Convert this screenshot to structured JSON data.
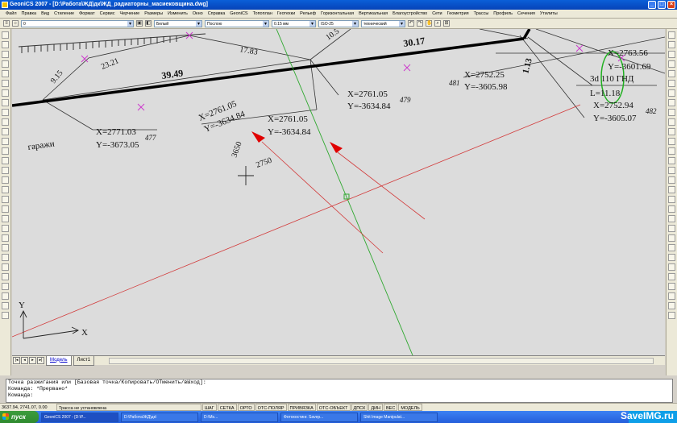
{
  "window": {
    "title": "GeoniCS 2007 - [D:\\Работа\\ЖД\\дк\\ЖД_радиаторны_масиековщина.dwg]"
  },
  "menu": [
    "Файл",
    "Правка",
    "Вид",
    "Стиление",
    "Формат",
    "Сервис",
    "Черчение",
    "Размеры",
    "Изменить",
    "Окно",
    "Справка",
    "GeoniCS",
    "Топоплан",
    "Геотехки",
    "Рельеф",
    "Горизонтальная",
    "Вертикальная",
    "Благоустройство",
    "Сети",
    "Геометрия",
    "Трассы",
    "Профиль",
    "Сечения",
    "Утилиты"
  ],
  "toolbar": {
    "layer": "0",
    "color": "Белый",
    "linetype": "Послою",
    "lineweight": "0.15 мм",
    "dimstyle": "ISO-25",
    "textstyle": "технический"
  },
  "drawing": {
    "lengths": [
      "9.15",
      "23.21",
      "17.83",
      "10.5",
      "30.17",
      "39.49",
      "1.13"
    ],
    "labels": [
      "X=2761.05",
      "Y=-3634.84",
      "479",
      "X=2761.05",
      "Y=-3634.84",
      "X=2761.05",
      "Y=-3634.84",
      "X=2752.25",
      "Y=-3605.98",
      "481",
      "X=2771.03",
      "Y=-3673.05",
      "477",
      "X=2763.56",
      "Y=-3601.69",
      "3d 110 ГНД",
      "L=11.18",
      "X=2752.94",
      "Y=-3605.07",
      "482",
      "гаражи",
      "3650",
      "2750"
    ],
    "ucs": {
      "x": "X",
      "y": "Y"
    }
  },
  "tabs": [
    "Модель",
    "Лист1"
  ],
  "command": [
    "Точка разжигания или [Базовая точка/Копировать/ОТменить/вЫход]:",
    "Команда: *Прервано*",
    "Команда:"
  ],
  "status": {
    "coords": "3637.94, 2741.07, 0.00",
    "message": "Трасса не установлена",
    "toggles": [
      "ШАГ",
      "СЕТКА",
      "ОРТО",
      "ОТС-ПОЛЯР",
      "ПРИВЯЗКА",
      "ОТС-ОБЪЕКТ",
      "ДПСК",
      "ДИН",
      "ВЕС",
      "МОДЕЛЬ"
    ]
  },
  "taskbar": {
    "start": "пуск",
    "tasks": [
      "GeoniCS 2007 - [D:\\Р...",
      "D:\\Работа\\ЖД\\дк\\",
      "D:\\Ms...",
      "Фотохостинг. Savep...",
      "Shit Image Manipulat..."
    ]
  },
  "watermark": "SaveIMG.ru"
}
